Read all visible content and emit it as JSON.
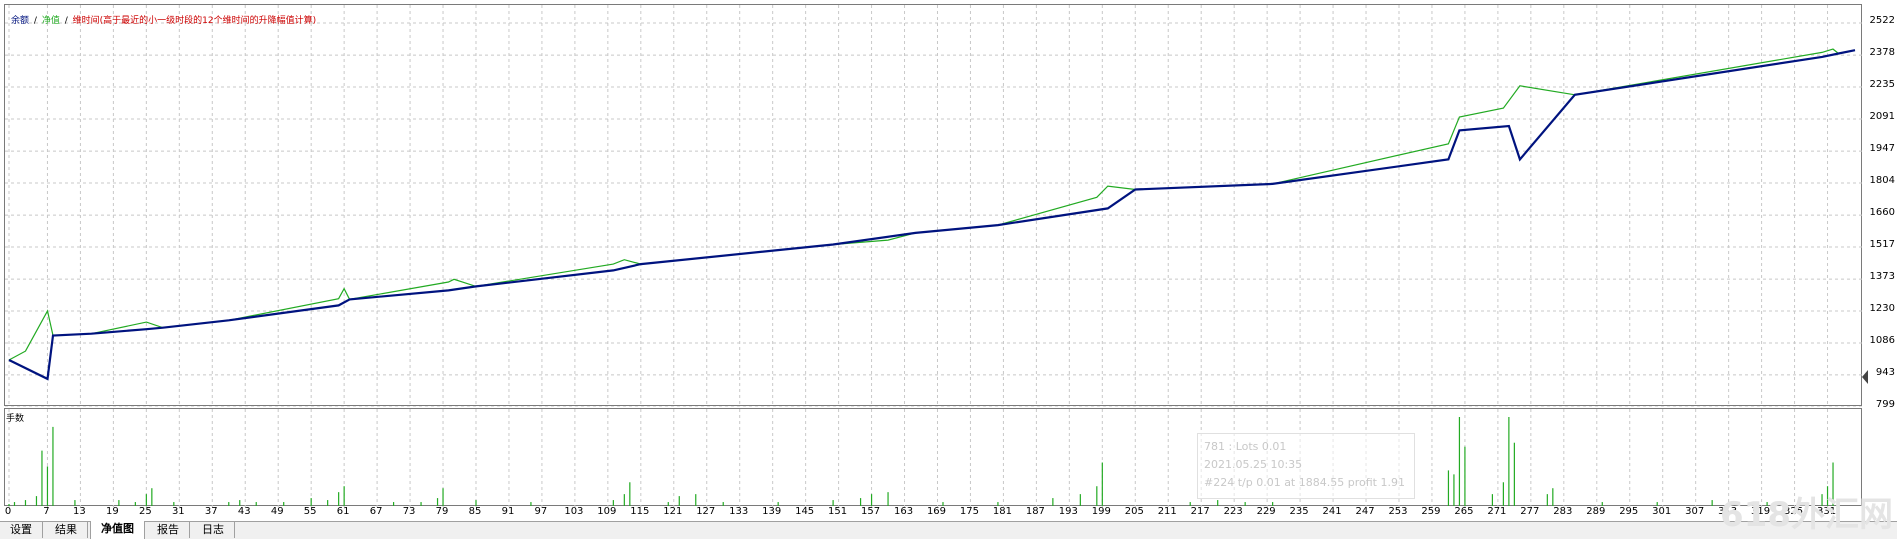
{
  "legend": {
    "balance": "余额",
    "equity": "净值",
    "lots": "维时间(高于最近的小一级时段的12个维时间的升降幅值计算)",
    "sep": "/"
  },
  "volume_label": "手数",
  "y_ticks": [
    "2522",
    "2378",
    "2235",
    "2091",
    "1947",
    "1804",
    "1660",
    "1517",
    "1373",
    "1230",
    "1086",
    "943",
    "799"
  ],
  "x_ticks": [
    "0",
    "7",
    "13",
    "19",
    "25",
    "31",
    "37",
    "43",
    "49",
    "55",
    "61",
    "67",
    "73",
    "79",
    "85",
    "91",
    "97",
    "103",
    "109",
    "115",
    "121",
    "127",
    "133",
    "139",
    "145",
    "151",
    "157",
    "163",
    "169",
    "175",
    "181",
    "187",
    "193",
    "199",
    "205",
    "211",
    "217",
    "223",
    "229",
    "235",
    "241",
    "247",
    "253",
    "259",
    "265",
    "271",
    "277",
    "283",
    "289",
    "295",
    "301",
    "307",
    "313",
    "319",
    "325",
    "331"
  ],
  "tooltip": {
    "line1": "781 : Lots 0.01",
    "line2": "2021.05.25 10:35",
    "line3": "#224 t/p 0.01 at 1884.55 profit 1.91"
  },
  "tabs": [
    {
      "label": "设置",
      "active": false
    },
    {
      "label": "结果",
      "active": false
    },
    {
      "label": "净值图",
      "active": true
    },
    {
      "label": "报告",
      "active": false
    },
    {
      "label": "日志",
      "active": false
    }
  ],
  "watermark": "618外汇网",
  "colors": {
    "balance": "#00137f",
    "equity": "#22aa22",
    "lots_text": "#cc0000",
    "grid": "#c8c8c8",
    "volume": "#22aa22"
  },
  "chart_data": {
    "type": "line",
    "series": [
      {
        "name": "余额",
        "x": [
          0,
          7,
          8,
          15,
          25,
          28,
          40,
          60,
          62,
          80,
          85,
          110,
          115,
          150,
          165,
          180,
          200,
          205,
          230,
          262,
          264,
          273,
          275,
          285,
          330,
          333,
          336
        ],
        "y": [
          1010,
          925,
          1120,
          1128,
          1148,
          1155,
          1188,
          1255,
          1282,
          1322,
          1340,
          1412,
          1440,
          1528,
          1580,
          1615,
          1690,
          1775,
          1800,
          1910,
          2040,
          2060,
          1910,
          2200,
          2370,
          2385,
          2400
        ]
      },
      {
        "name": "净值",
        "x": [
          0,
          3,
          7,
          8,
          15,
          25,
          28,
          40,
          60,
          61,
          62,
          80,
          81,
          85,
          110,
          112,
          115,
          150,
          160,
          165,
          180,
          198,
          200,
          205,
          230,
          262,
          264,
          272,
          275,
          285,
          330,
          332,
          333,
          336
        ],
        "y": [
          1010,
          1050,
          1230,
          1120,
          1128,
          1180,
          1155,
          1188,
          1285,
          1330,
          1282,
          1360,
          1372,
          1340,
          1440,
          1460,
          1440,
          1528,
          1548,
          1580,
          1615,
          1740,
          1790,
          1775,
          1800,
          1980,
          2100,
          2140,
          2240,
          2200,
          2390,
          2405,
          2385,
          2400
        ]
      }
    ],
    "ylim": [
      799,
      2522
    ],
    "xlim": [
      0,
      336
    ],
    "volume": [
      [
        0,
        1
      ],
      [
        1,
        2
      ],
      [
        3,
        3
      ],
      [
        5,
        5
      ],
      [
        6,
        28
      ],
      [
        7,
        20
      ],
      [
        8,
        40
      ],
      [
        12,
        3
      ],
      [
        20,
        3
      ],
      [
        23,
        2
      ],
      [
        25,
        6
      ],
      [
        26,
        9
      ],
      [
        30,
        2
      ],
      [
        40,
        2
      ],
      [
        42,
        3
      ],
      [
        45,
        2
      ],
      [
        50,
        2
      ],
      [
        55,
        4
      ],
      [
        58,
        3
      ],
      [
        60,
        7
      ],
      [
        61,
        10
      ],
      [
        70,
        2
      ],
      [
        75,
        2
      ],
      [
        78,
        4
      ],
      [
        79,
        9
      ],
      [
        85,
        3
      ],
      [
        95,
        2
      ],
      [
        110,
        3
      ],
      [
        112,
        6
      ],
      [
        113,
        12
      ],
      [
        120,
        2
      ],
      [
        122,
        5
      ],
      [
        125,
        6
      ],
      [
        130,
        2
      ],
      [
        140,
        2
      ],
      [
        150,
        3
      ],
      [
        155,
        4
      ],
      [
        157,
        6
      ],
      [
        160,
        7
      ],
      [
        170,
        2
      ],
      [
        180,
        2
      ],
      [
        190,
        4
      ],
      [
        195,
        6
      ],
      [
        198,
        10
      ],
      [
        199,
        22
      ],
      [
        215,
        2
      ],
      [
        220,
        3
      ],
      [
        225,
        2
      ],
      [
        230,
        2
      ],
      [
        262,
        18
      ],
      [
        263,
        16
      ],
      [
        264,
        45
      ],
      [
        265,
        30
      ],
      [
        270,
        6
      ],
      [
        272,
        12
      ],
      [
        273,
        45
      ],
      [
        274,
        32
      ],
      [
        280,
        6
      ],
      [
        281,
        9
      ],
      [
        290,
        2
      ],
      [
        300,
        2
      ],
      [
        310,
        3
      ],
      [
        320,
        2
      ],
      [
        330,
        6
      ],
      [
        331,
        10
      ],
      [
        332,
        22
      ]
    ]
  }
}
